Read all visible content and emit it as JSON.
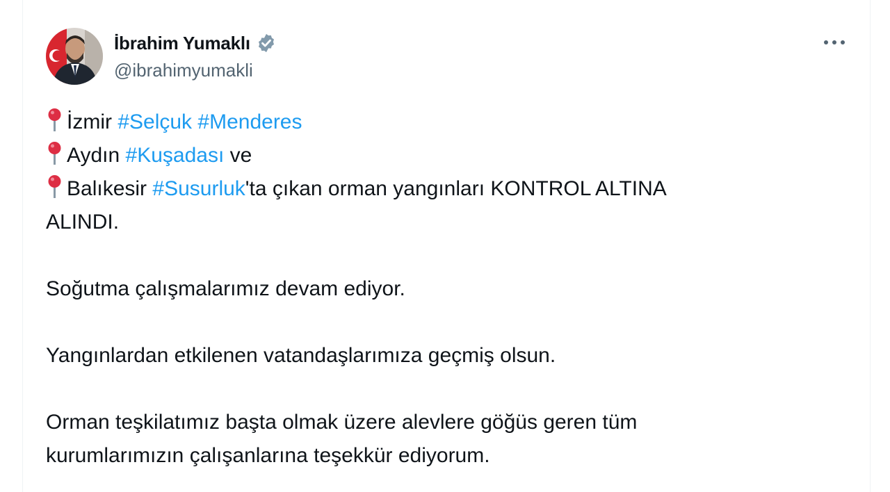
{
  "author": {
    "name": "İbrahim Yumaklı",
    "handle": "@ibrahimyumakli"
  },
  "tweet": {
    "line1": {
      "place": "İzmir",
      "tag1": "#Selçuk",
      "tag2": "#Menderes"
    },
    "line2": {
      "place": "Aydın",
      "tag": "#Kuşadası",
      "tail": "ve"
    },
    "line3": {
      "place": "Balıkesir",
      "tag": "#Susurluk",
      "tail": "'ta çıkan orman yangınları KONTROL ALTINA"
    },
    "line3b": "ALINDI.",
    "para2": "Soğutma çalışmalarımız devam ediyor.",
    "para3": "Yangınlardan etkilenen vatandaşlarımıza geçmiş olsun.",
    "para4_line1": "Orman teşkilatımız başta olmak üzere alevlere göğüs geren tüm",
    "para4_line2": "kurumlarımızın çalışanlarına teşekkür ediyorum."
  },
  "icons": {
    "verified": "verified-badge-icon",
    "more": "more-options-icon",
    "pin": "round-pushpin-icon"
  },
  "colors": {
    "link": "#1d9bf0",
    "text": "#0f1419",
    "secondary": "#536471",
    "pin_head": "#dd2e44"
  }
}
